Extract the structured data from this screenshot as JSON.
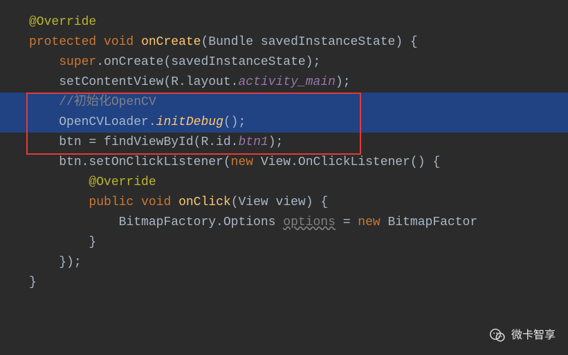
{
  "code": {
    "sp": " ",
    "ind1": "    ",
    "ind2": "        ",
    "ind3": "            ",
    "l1": "@Override",
    "l2a": "protected",
    "l2b": "void",
    "l2c": "onCreate",
    "l2d": "(Bundle savedInstanceState) {",
    "l3a": "super",
    "l3b": ".onCreate(savedInstanceState);",
    "l4a": "setContentView(R.layout.",
    "l4b": "activity_main",
    "l4c": ");",
    "l6": "//初始化OpenCV",
    "l7a": "OpenCVLoader.",
    "l7b": "initDebug",
    "l7c": "();",
    "l9a": "btn = findViewById(R.id.",
    "l9b": "btn1",
    "l9c": ");",
    "l10a": "btn.setOnClickListener(",
    "l10b": "new",
    "l10c": " View.OnClickListener() {",
    "l11": "@Override",
    "l12a": "public",
    "l12b": "void",
    "l12c": "onClick",
    "l12d": "(View view) {",
    "l13a": "BitmapFactory.Options ",
    "l13b": "options",
    "l13c": " = ",
    "l13d": "new",
    "l13e": " BitmapFactor",
    "l15": "}",
    "l16": "});",
    "l17": "}"
  },
  "watermark": {
    "text": "微卡智享"
  }
}
